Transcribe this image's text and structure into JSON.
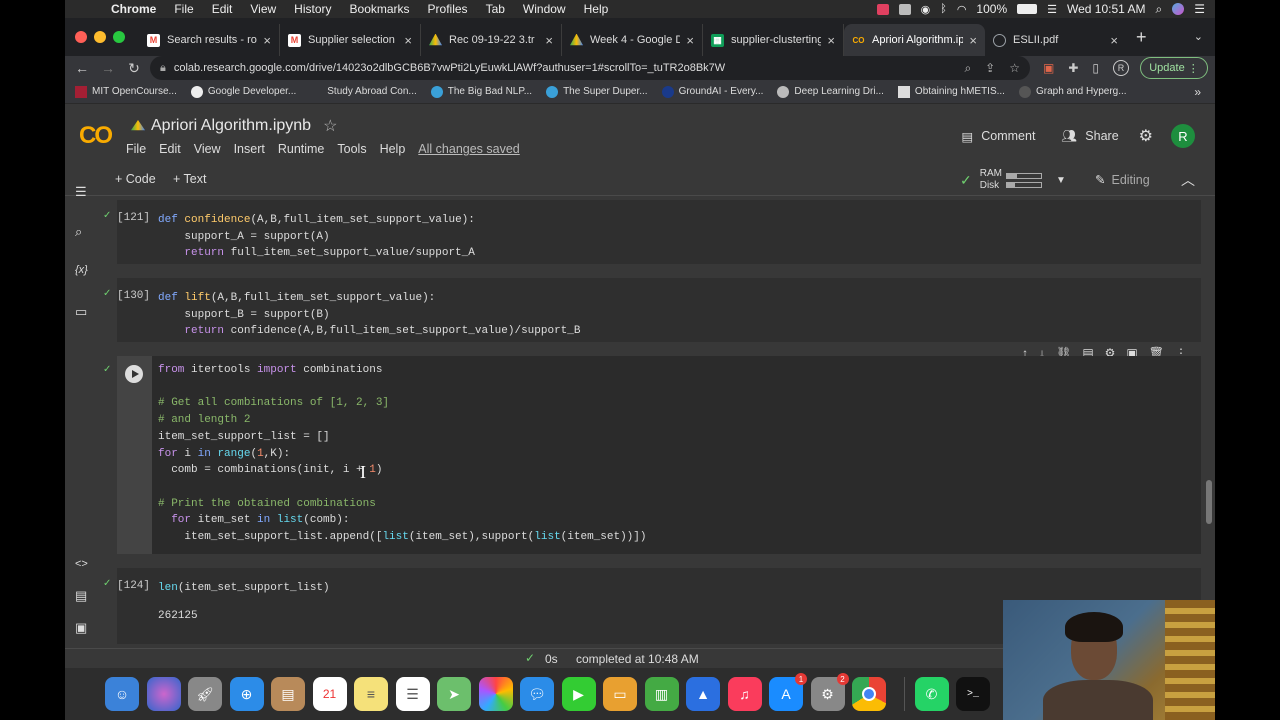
{
  "macbar": {
    "app": "Chrome",
    "menus": [
      "File",
      "Edit",
      "View",
      "History",
      "Bookmarks",
      "Profiles",
      "Tab",
      "Window",
      "Help"
    ],
    "battery": "100%",
    "datetime": "Wed 10:51 AM"
  },
  "tabs": [
    {
      "title": "Search results - roh",
      "icon": "gmail-icon",
      "color": "#ea4335"
    },
    {
      "title": "Supplier selection c",
      "icon": "gmail-icon",
      "color": "#ea4335"
    },
    {
      "title": "Rec 09-19-22 3.tr",
      "icon": "drive-icon",
      "color": "#fbbc04"
    },
    {
      "title": "Week 4 - Google Dr",
      "icon": "drive-icon",
      "color": "#fbbc04"
    },
    {
      "title": "supplier-clusterting",
      "icon": "sheets-icon",
      "color": "#0f9d58"
    },
    {
      "title": "Apriori Algorithm.ip",
      "icon": "colab-icon",
      "color": "#f9ab00",
      "active": true
    },
    {
      "title": "ESLII.pdf",
      "icon": "globe-icon",
      "color": "#9aa0a6"
    }
  ],
  "address": {
    "url": "colab.research.google.com/drive/14023o2dlbGCB6B7vwPti2LyEuwkLlAWf?authuser=1#scrollTo=_tuTR2o8Bk7W",
    "update_label": "Update"
  },
  "bookmarks": [
    "MIT OpenCourse...",
    "Google Developer...",
    "Study Abroad Con...",
    "The Big Bad NLP...",
    "The Super Duper...",
    "GroundAI - Every...",
    "Deep Learning Dri...",
    "Obtaining hMETIS...",
    "Graph and Hyperg..."
  ],
  "colab": {
    "logo": "CO",
    "title": "Apriori Algorithm.ipynb",
    "menus": [
      "File",
      "Edit",
      "View",
      "Insert",
      "Runtime",
      "Tools",
      "Help"
    ],
    "saved": "All changes saved",
    "comment": "Comment",
    "share": "Share",
    "avatar": "R"
  },
  "toolbar": {
    "code": "+ Code",
    "text": "+ Text",
    "ram": "RAM",
    "disk": "Disk",
    "ram_level": 0.3,
    "disk_level": 0.25,
    "editing": "Editing"
  },
  "cells": {
    "c1": {
      "num": "[121]"
    },
    "c2": {
      "num": "[130]"
    },
    "c4": {
      "num": "[124]",
      "output": "262125"
    }
  },
  "status": {
    "time": "0s",
    "text": "completed at 10:48 AM"
  }
}
